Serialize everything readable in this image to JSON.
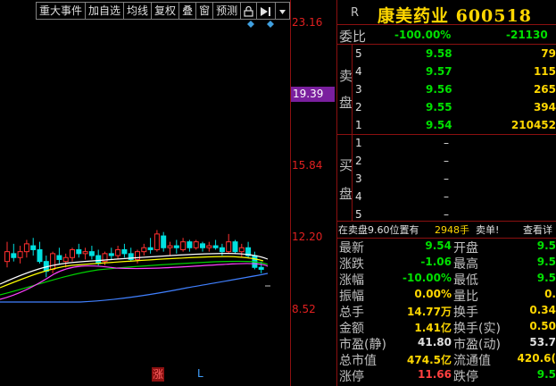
{
  "toolbar": {
    "items": [
      "重大事件",
      "加自选",
      "均线",
      "复权",
      "叠",
      "窗",
      "预测"
    ],
    "lock_icon": "lock-icon",
    "arrow_icon": "chevron-right-bar-icon",
    "menu_icon": "dropdown-icon"
  },
  "chart": {
    "price_ticks": [
      "23.16",
      "19.39",
      "15.84",
      "12.20",
      "8.52"
    ],
    "zhang": "涨",
    "l_mark": "L",
    "candles": [
      {
        "o": 10.9,
        "h": 11.9,
        "l": 10.6,
        "c": 11.4,
        "up": true
      },
      {
        "o": 11.3,
        "h": 11.8,
        "l": 10.9,
        "c": 11.1,
        "up": false
      },
      {
        "o": 11.1,
        "h": 11.7,
        "l": 10.8,
        "c": 11.4,
        "up": true
      },
      {
        "o": 11.4,
        "h": 12.0,
        "l": 11.1,
        "c": 11.8,
        "up": true
      },
      {
        "o": 11.7,
        "h": 12.1,
        "l": 11.2,
        "c": 11.5,
        "up": false
      },
      {
        "o": 11.5,
        "h": 11.9,
        "l": 10.8,
        "c": 10.9,
        "up": false
      },
      {
        "o": 10.9,
        "h": 11.2,
        "l": 10.1,
        "c": 10.4,
        "up": false
      },
      {
        "o": 10.5,
        "h": 11.4,
        "l": 10.3,
        "c": 11.3,
        "up": true
      },
      {
        "o": 11.2,
        "h": 11.6,
        "l": 10.8,
        "c": 11.0,
        "up": false
      },
      {
        "o": 10.9,
        "h": 11.3,
        "l": 10.6,
        "c": 11.1,
        "up": true
      },
      {
        "o": 11.1,
        "h": 11.6,
        "l": 10.9,
        "c": 11.5,
        "up": true
      },
      {
        "o": 11.5,
        "h": 11.8,
        "l": 11.1,
        "c": 11.3,
        "up": false
      },
      {
        "o": 11.3,
        "h": 11.6,
        "l": 11.0,
        "c": 11.4,
        "up": true
      },
      {
        "o": 11.4,
        "h": 11.7,
        "l": 11.0,
        "c": 11.2,
        "up": false
      },
      {
        "o": 11.2,
        "h": 11.5,
        "l": 10.7,
        "c": 10.8,
        "up": false
      },
      {
        "o": 10.9,
        "h": 11.4,
        "l": 10.7,
        "c": 11.3,
        "up": true
      },
      {
        "o": 11.3,
        "h": 11.6,
        "l": 11.0,
        "c": 11.2,
        "up": false
      },
      {
        "o": 11.2,
        "h": 11.7,
        "l": 11.0,
        "c": 11.5,
        "up": true
      },
      {
        "o": 11.5,
        "h": 11.8,
        "l": 11.1,
        "c": 11.3,
        "up": false
      },
      {
        "o": 11.3,
        "h": 11.6,
        "l": 10.9,
        "c": 11.0,
        "up": false
      },
      {
        "o": 11.0,
        "h": 11.5,
        "l": 10.8,
        "c": 11.4,
        "up": true
      },
      {
        "o": 11.4,
        "h": 11.8,
        "l": 11.2,
        "c": 11.6,
        "up": true
      },
      {
        "o": 11.6,
        "h": 12.1,
        "l": 11.3,
        "c": 11.5,
        "up": false
      },
      {
        "o": 11.5,
        "h": 12.5,
        "l": 11.4,
        "c": 12.3,
        "up": true
      },
      {
        "o": 12.2,
        "h": 12.4,
        "l": 11.4,
        "c": 11.6,
        "up": false
      },
      {
        "o": 11.6,
        "h": 11.9,
        "l": 11.2,
        "c": 11.7,
        "up": true
      },
      {
        "o": 11.7,
        "h": 12.0,
        "l": 11.3,
        "c": 11.6,
        "up": false
      },
      {
        "o": 11.5,
        "h": 12.1,
        "l": 11.4,
        "c": 11.9,
        "up": true
      },
      {
        "o": 11.9,
        "h": 12.0,
        "l": 11.4,
        "c": 11.6,
        "up": false
      },
      {
        "o": 11.6,
        "h": 12.0,
        "l": 11.5,
        "c": 11.9,
        "up": true
      },
      {
        "o": 11.8,
        "h": 11.9,
        "l": 11.4,
        "c": 11.6,
        "up": false
      },
      {
        "o": 11.6,
        "h": 11.9,
        "l": 11.4,
        "c": 11.7,
        "up": true
      },
      {
        "o": 11.7,
        "h": 12.0,
        "l": 11.5,
        "c": 11.6,
        "up": false
      },
      {
        "o": 11.6,
        "h": 11.8,
        "l": 11.2,
        "c": 11.4,
        "up": false
      },
      {
        "o": 11.4,
        "h": 12.3,
        "l": 11.3,
        "c": 11.9,
        "up": true
      },
      {
        "o": 11.9,
        "h": 12.0,
        "l": 11.3,
        "c": 11.4,
        "up": false
      },
      {
        "o": 11.4,
        "h": 11.8,
        "l": 11.1,
        "c": 11.6,
        "up": true
      },
      {
        "o": 11.6,
        "h": 11.9,
        "l": 11.1,
        "c": 11.2,
        "up": false
      },
      {
        "o": 11.2,
        "h": 11.4,
        "l": 10.5,
        "c": 10.6,
        "up": false
      },
      {
        "o": 10.6,
        "h": 10.9,
        "l": 10.3,
        "c": 10.5,
        "up": false
      }
    ]
  },
  "panel": {
    "code_prefix": "R",
    "name": "康美药业 600518",
    "weibi_label": "委比",
    "weibi_pct": "-100.00%",
    "weibi_val": "-21130",
    "sell_label": [
      "卖",
      "盘"
    ],
    "buy_label": [
      "买",
      "盘"
    ],
    "sell": [
      {
        "n": "5",
        "p": "9.58",
        "v": "79"
      },
      {
        "n": "4",
        "p": "9.57",
        "v": "115"
      },
      {
        "n": "3",
        "p": "9.56",
        "v": "265"
      },
      {
        "n": "2",
        "p": "9.55",
        "v": "394"
      },
      {
        "n": "1",
        "p": "9.54",
        "v": "210452"
      }
    ],
    "buy": [
      {
        "n": "1",
        "p": "–"
      },
      {
        "n": "2",
        "p": "–"
      },
      {
        "n": "3",
        "p": "–"
      },
      {
        "n": "4",
        "p": "–"
      },
      {
        "n": "5",
        "p": "–"
      }
    ],
    "notice": {
      "a": "在卖盘9.60位置有",
      "b": "2948手",
      "c": "卖单!",
      "d": "查看详"
    },
    "quotes": [
      {
        "l1": "最新",
        "v1": "9.54",
        "c1": "green",
        "l2": "开盘",
        "v2": "9.5",
        "c2": "green"
      },
      {
        "l1": "涨跌",
        "v1": "-1.06",
        "c1": "green",
        "l2": "最高",
        "v2": "9.5",
        "c2": "green"
      },
      {
        "l1": "涨幅",
        "v1": "-10.00%",
        "c1": "green",
        "l2": "最低",
        "v2": "9.5",
        "c2": "green"
      },
      {
        "l1": "振幅",
        "v1": "0.00%",
        "c1": "yellow",
        "l2": "量比",
        "v2": "0.",
        "c2": "yellow"
      },
      {
        "l1": "总手",
        "v1": "14.77万",
        "c1": "yellow",
        "l2": "换手",
        "v2": "0.34",
        "c2": "yellow"
      },
      {
        "l1": "金额",
        "v1": "1.41亿",
        "c1": "yellow",
        "l2": "换手(实)",
        "v2": "0.50",
        "c2": "yellow"
      },
      {
        "l1": "市盈(静)",
        "v1": "41.80",
        "c1": "white",
        "l2": "市盈(动)",
        "v2": "53.7",
        "c2": "white"
      },
      {
        "l1": "总市值",
        "v1": "474.5亿",
        "c1": "yellow",
        "l2": "流通值",
        "v2": "420.6(",
        "c2": "yellow"
      },
      {
        "l1": "涨停",
        "v1": "11.66",
        "c1": "red",
        "l2": "跌停",
        "v2": "9.5",
        "c2": "green"
      }
    ]
  }
}
